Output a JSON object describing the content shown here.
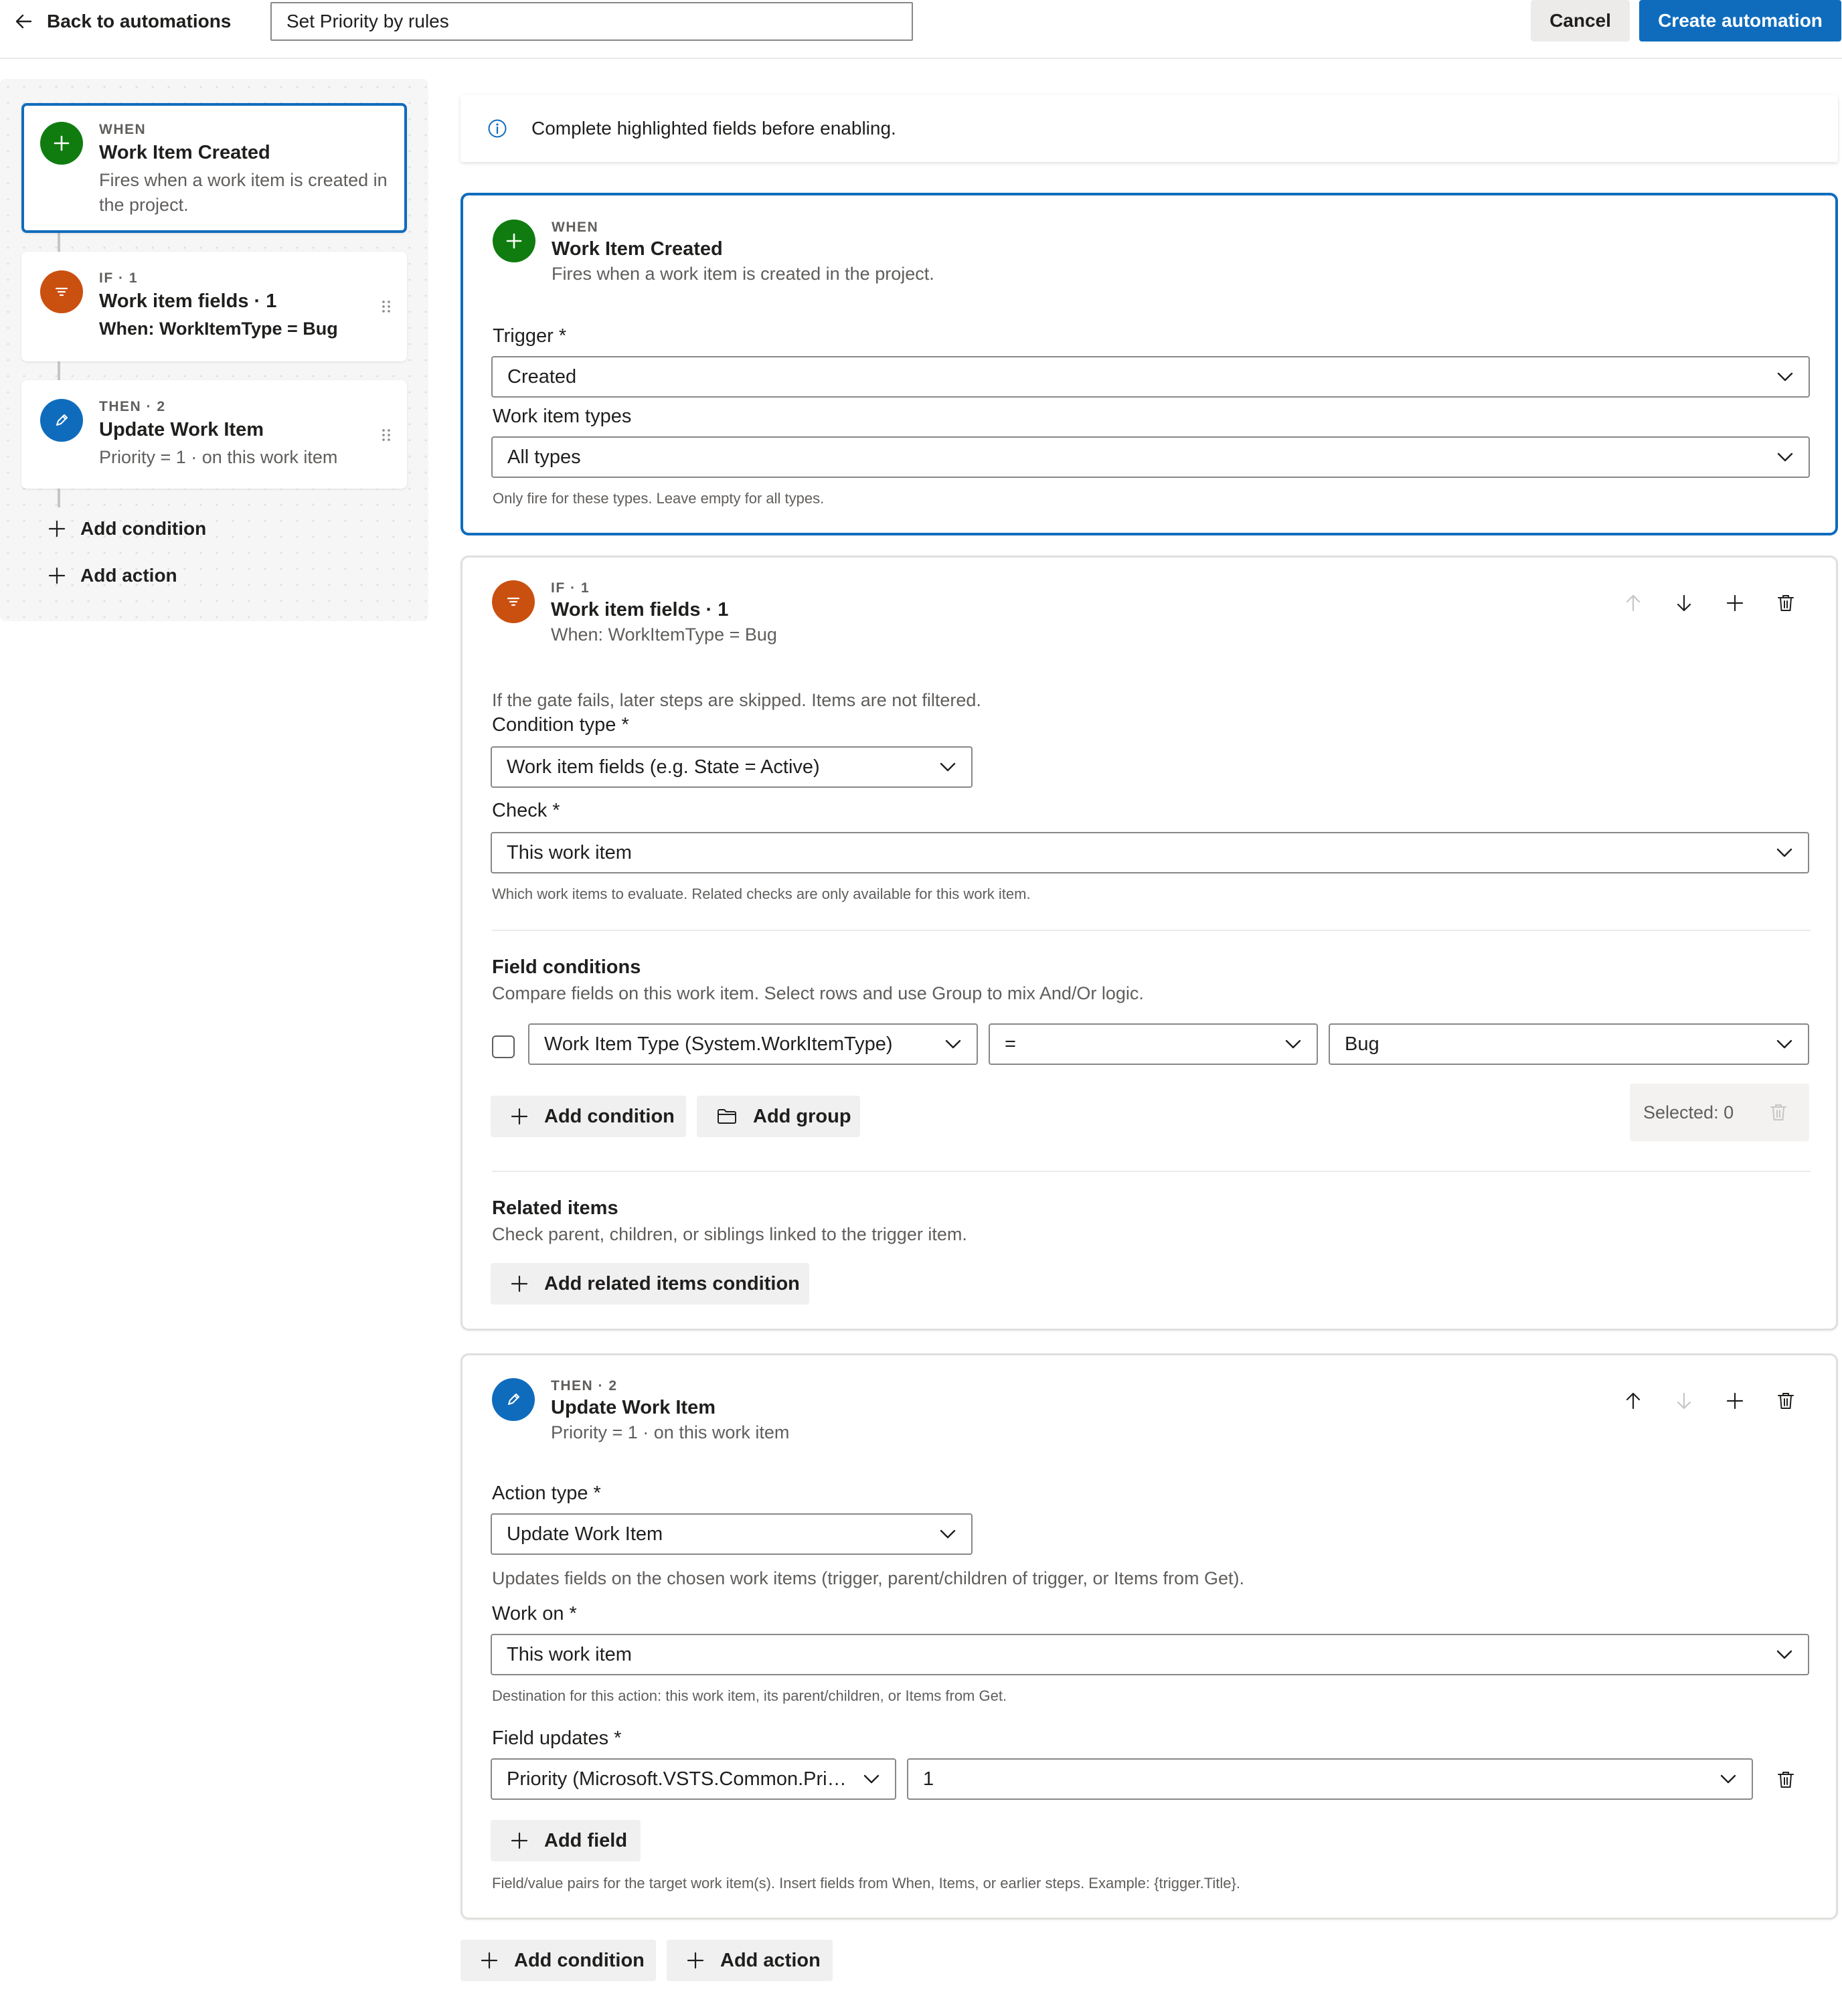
{
  "header": {
    "back_label": "Back to automations",
    "automation_name": "Set Priority by rules",
    "cancel_label": "Cancel",
    "create_label": "Create automation"
  },
  "colors": {
    "accent": "#0f6cbd",
    "when": "#107c10",
    "if": "#ca5010",
    "then": "#0f6cbd"
  },
  "sidebar": {
    "steps": [
      {
        "eyebrow": "WHEN",
        "title": "Work Item Created",
        "subtitle": "Fires when a work item is created in the project.",
        "icon": "plus-icon"
      },
      {
        "eyebrow": "IF · 1",
        "title": "Work item fields · 1",
        "subtitle": "When: WorkItemType = Bug",
        "icon": "filter-icon"
      },
      {
        "eyebrow": "THEN · 2",
        "title": "Update Work Item",
        "subtitle": "Priority = 1 · on this work item",
        "icon": "pencil-icon"
      }
    ],
    "add_condition": "Add condition",
    "add_action": "Add action"
  },
  "notice": {
    "text": "Complete highlighted fields before enabling.",
    "icon": "info-icon"
  },
  "when_panel": {
    "eyebrow": "WHEN",
    "title": "Work Item Created",
    "subtitle": "Fires when a work item is created in the project.",
    "trigger_label": "Trigger *",
    "trigger_value": "Created",
    "types_label": "Work item types",
    "types_value": "All types",
    "types_help": "Only fire for these types. Leave empty for all types."
  },
  "if_panel": {
    "eyebrow": "IF · 1",
    "title": "Work item fields · 1",
    "subtitle": "When: WorkItemType = Bug",
    "gate_note": "If the gate fails, later steps are skipped. Items are not filtered.",
    "condition_type_label": "Condition type *",
    "condition_type_value": "Work item fields (e.g. State = Active)",
    "check_label": "Check *",
    "check_value": "This work item",
    "check_help": "Which work items to evaluate. Related checks are only available for this work item.",
    "field_conditions_title": "Field conditions",
    "field_conditions_desc": "Compare fields on this work item. Select rows and use Group to mix And/Or logic.",
    "row": {
      "field": "Work Item Type (System.WorkItemType)",
      "operator": "=",
      "value": "Bug"
    },
    "add_condition": "Add condition",
    "add_group": "Add group",
    "selected": "Selected: 0",
    "related_title": "Related items",
    "related_desc": "Check parent, children, or siblings linked to the trigger item.",
    "add_related": "Add related items condition"
  },
  "then_panel": {
    "eyebrow": "THEN · 2",
    "title": "Update Work Item",
    "subtitle": "Priority = 1 · on this work item",
    "action_type_label": "Action type *",
    "action_type_value": "Update Work Item",
    "action_help": "Updates fields on the chosen work items (trigger, parent/children of trigger, or Items from Get).",
    "work_on_label": "Work on *",
    "work_on_value": "This work item",
    "work_on_help": "Destination for this action: this work item, its parent/children, or Items from Get.",
    "field_updates_label": "Field updates *",
    "update_field": "Priority (Microsoft.VSTS.Common.Prio...",
    "update_value": "1",
    "add_field": "Add field",
    "field_help": "Field/value pairs for the target work item(s). Insert fields from When, Items, or earlier steps. Example: {trigger.Title}."
  },
  "bottom": {
    "add_condition": "Add condition",
    "add_action": "Add action"
  }
}
